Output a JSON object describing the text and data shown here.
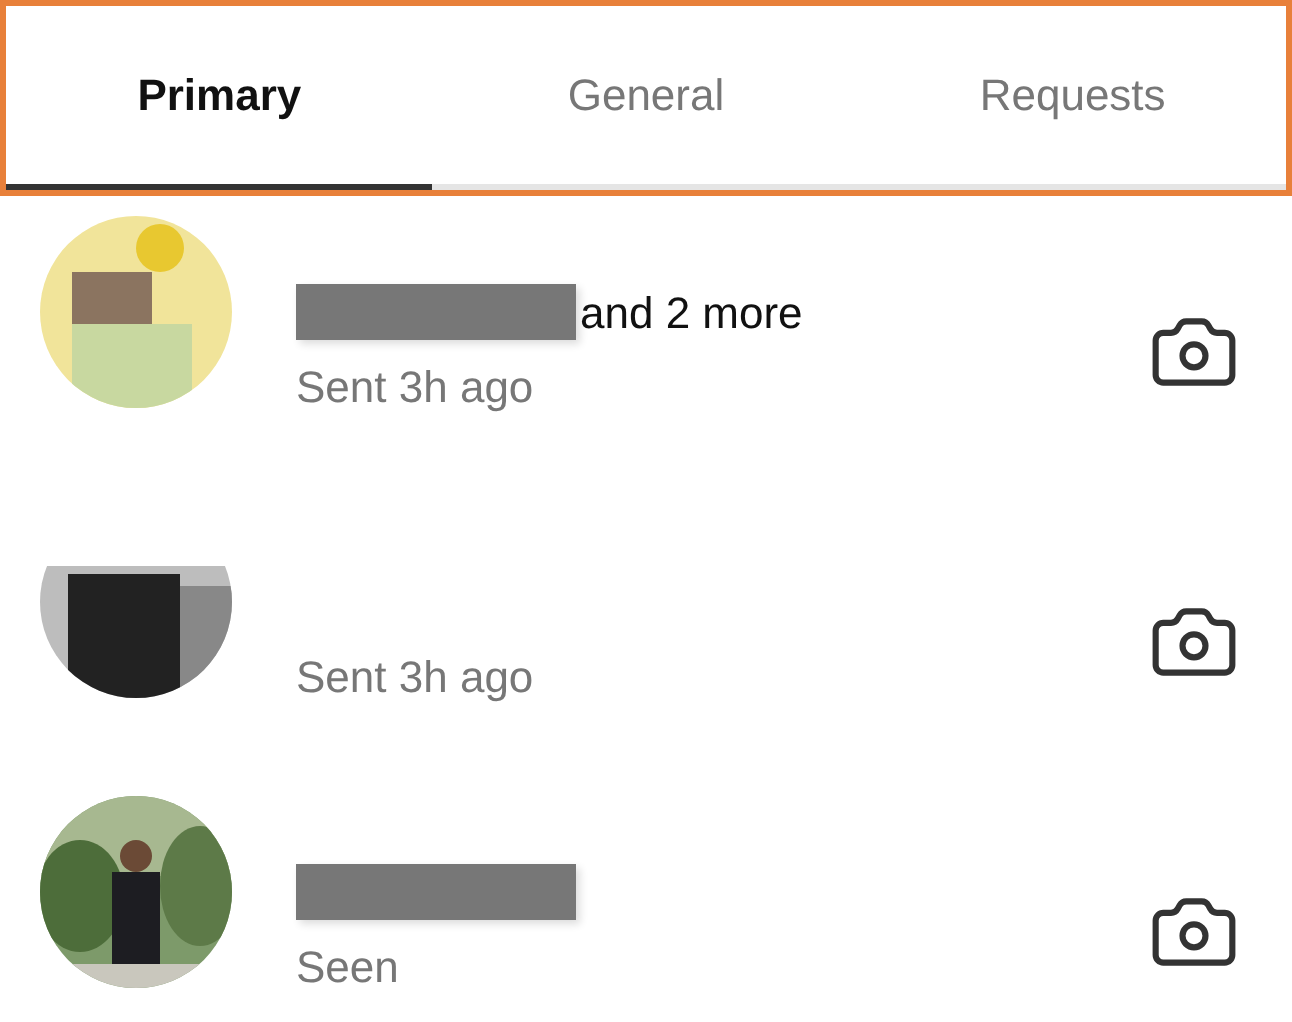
{
  "tabs": [
    {
      "label": "Primary",
      "selected": true
    },
    {
      "label": "General",
      "selected": false
    },
    {
      "label": "Requests",
      "selected": false
    }
  ],
  "threads": [
    {
      "name_redacted": true,
      "name": "and 2 more",
      "status": "Sent 3h ago"
    },
    {
      "name_redacted": false,
      "status": "Sent 3h ago"
    },
    {
      "name_redacted": true,
      "status": "Seen"
    }
  ]
}
